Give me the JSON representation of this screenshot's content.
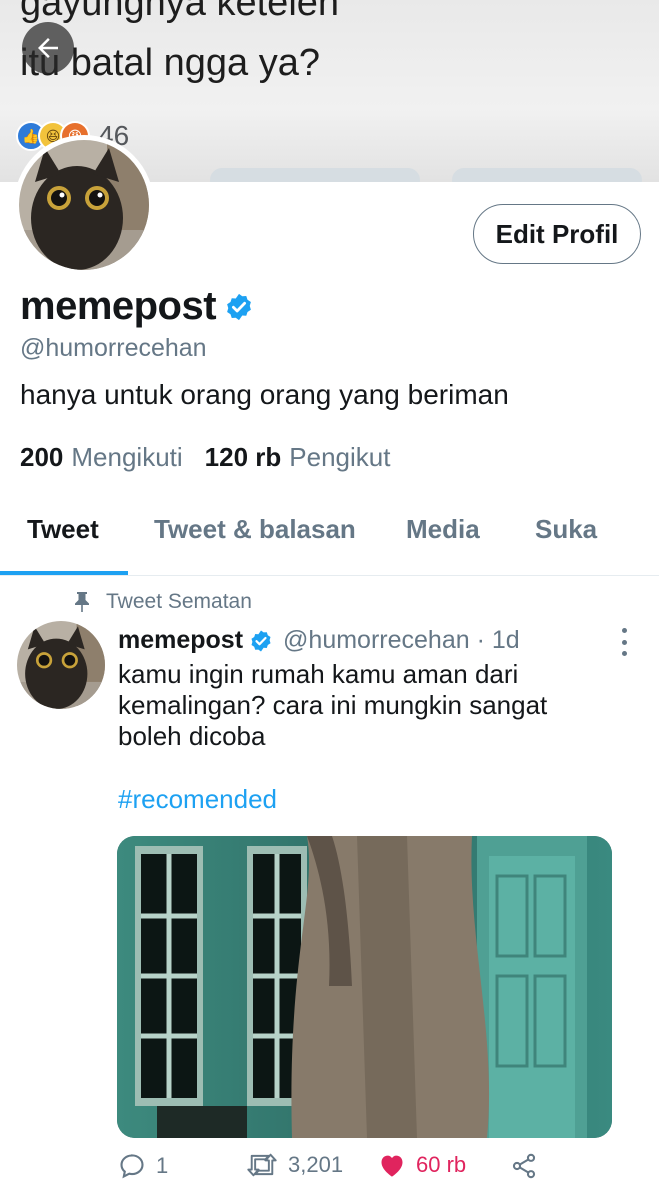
{
  "banner": {
    "line1": "gayungnya ketelen",
    "line2": "itu batal ngga ya?",
    "reaction_count": "46"
  },
  "profile": {
    "edit_label": "Edit Profil",
    "display_name": "memepost",
    "handle": "@humorrecehan",
    "bio": "hanya untuk orang orang yang beriman",
    "following_count": "200",
    "following_label": "Mengikuti",
    "followers_count": "120 rb",
    "followers_label": "Pengikut"
  },
  "tabs": [
    {
      "label": "Tweet",
      "active": true
    },
    {
      "label": "Tweet & balasan",
      "active": false
    },
    {
      "label": "Media",
      "active": false
    },
    {
      "label": "Suka",
      "active": false
    }
  ],
  "tweet": {
    "pinned_label": "Tweet Sematan",
    "name": "memepost",
    "handle_time": "@humorrecehan · 1d",
    "text": "kamu ingin rumah kamu aman dari kemalingan? cara ini mungkin sangat boleh dicoba",
    "hashtag": "#recomended",
    "replies": "1",
    "retweets": "3,201",
    "likes": "60 rb"
  },
  "colors": {
    "accent": "#1da1f2",
    "like": "#e0245e",
    "secondary_text": "#657786"
  }
}
